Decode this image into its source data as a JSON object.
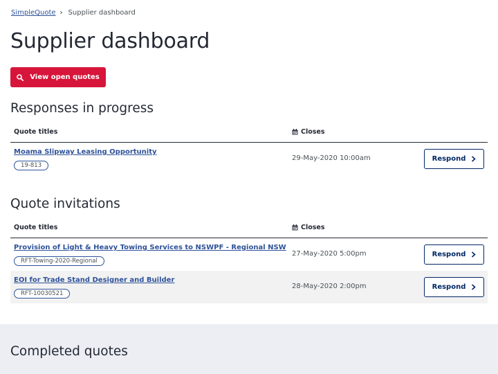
{
  "breadcrumb": {
    "home": "SimpleQuote",
    "separator": "›",
    "current": "Supplier dashboard"
  },
  "page_title": "Supplier dashboard",
  "primary_action": {
    "label": "View open quotes",
    "icon": "search-icon"
  },
  "responses_in_progress": {
    "title": "Responses in progress",
    "columns": {
      "title": "Quote titles",
      "closes": "Closes"
    },
    "rows": [
      {
        "title": "Moama Slipway Leasing Opportunity",
        "tag": "19-813",
        "closes": "29-May-2020 10:00am",
        "action": "Respond"
      }
    ]
  },
  "quote_invitations": {
    "title": "Quote invitations",
    "columns": {
      "title": "Quote titles",
      "closes": "Closes"
    },
    "rows": [
      {
        "title": "Provision of Light & Heavy Towing Services to NSWPF - Regional NSW",
        "tag": "RFT-Towing-2020-Regional",
        "closes": "27-May-2020 5:00pm",
        "action": "Respond"
      },
      {
        "title": "EOI for Trade Stand Designer and Builder",
        "tag": "RFT-10030521",
        "closes": "28-May-2020 2:00pm",
        "action": "Respond"
      }
    ]
  },
  "completed_quotes": {
    "title": "Completed quotes"
  },
  "colors": {
    "primary_red": "#d7153a",
    "navy": "#002664",
    "link_blue": "#2e5299",
    "text_dark": "#242934",
    "band_bg": "#eceef4",
    "alt_row_bg": "#f2f2f2"
  }
}
